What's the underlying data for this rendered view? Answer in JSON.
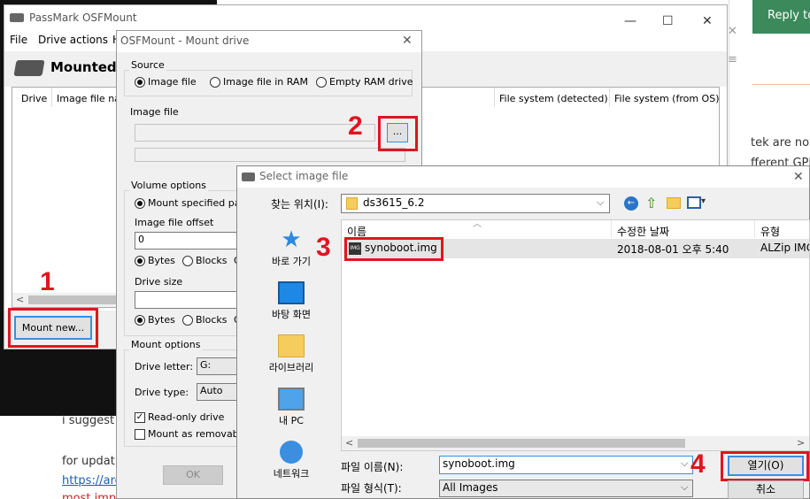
{
  "web": {
    "reply_button": "Reply to",
    "close_x": "✕",
    "menu_glyph": "≡",
    "snippet_1": "tek are now",
    "snippet_2": "fferent GPL",
    "comment_1": "i suggest t",
    "comment_2": "for updatin",
    "link_1": "https://arc",
    "comment_3": "most important is to have ai..."
  },
  "osf_main": {
    "title": "PassMark OSFMount",
    "menus": [
      "File",
      "Drive actions",
      "H"
    ],
    "heading": "Mounted vir",
    "columns": [
      "Drive",
      "Image file nam",
      "File system (detected)",
      "File system (from OS)"
    ],
    "mount_new_button": "Mount new...",
    "scroll_left": "<",
    "minimize": "—",
    "maximize": "☐",
    "close": "✕"
  },
  "mount_dialog": {
    "title": "OSFMount - Mount drive",
    "close": "✕",
    "source_group": "Source",
    "source_options": [
      "Image file",
      "Image file in RAM",
      "Empty RAM drive"
    ],
    "image_file_group": "Image file",
    "browse_button": "...",
    "volume_group": "Volume options",
    "mount_specified": "Mount specified parti",
    "offset_label": "Image file offset",
    "offset_value": "0",
    "units": [
      "Bytes",
      "Blocks",
      "G"
    ],
    "drive_size_label": "Drive size",
    "mount_options_group": "Mount options",
    "drive_letter_label": "Drive letter:",
    "drive_letter_value": "G:",
    "drive_type_label": "Drive type:",
    "drive_type_value": "Auto",
    "readonly_label": "Read-only drive",
    "removable_label": "Mount as removable",
    "ok_button": "OK"
  },
  "file_dialog": {
    "title": "Select image file",
    "close": "✕",
    "look_in_label": "찾는 위치(I):",
    "look_in_value": "ds3615_6.2",
    "nav": [
      "바로 가기",
      "바탕 화면",
      "라이브러리",
      "내 PC",
      "네트워크"
    ],
    "columns": [
      "이름",
      "수정한 날짜",
      "유형"
    ],
    "file": {
      "name": "synoboot.img",
      "modified": "2018-08-01 오후 5:40",
      "type": "ALZip IMG",
      "icon_text": "IMG"
    },
    "filename_label": "파일 이름(N):",
    "filename_value": "synoboot.img",
    "filetype_label": "파일 형식(T):",
    "filetype_value": "All Images",
    "open_button": "열기(O)",
    "cancel_button": "취소",
    "scroll_left": "<",
    "scroll_right": ">"
  },
  "markers": [
    "1",
    "2",
    "3",
    "4"
  ],
  "colors": {
    "highlight_red": "#e0151f",
    "web_green": "#3c8a5c",
    "selection": "#cce8ff",
    "dialog_bg": "#f0f0f0",
    "dark_bg": "#111111"
  }
}
